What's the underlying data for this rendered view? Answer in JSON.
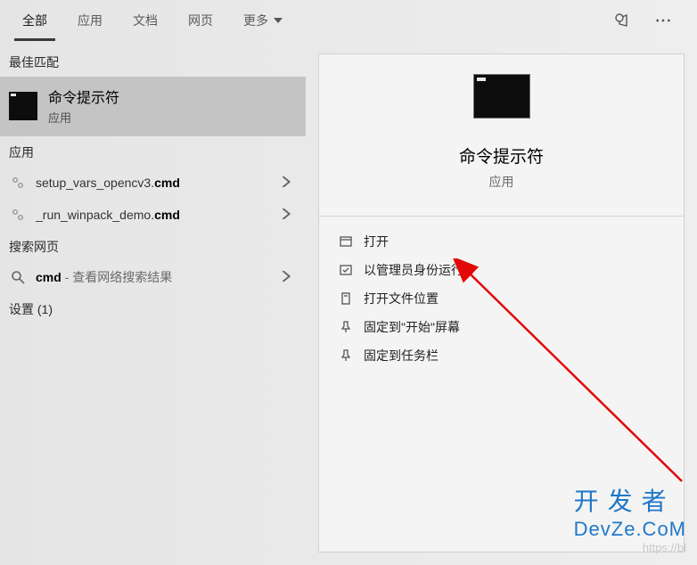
{
  "tabs": {
    "all": "全部",
    "apps": "应用",
    "docs": "文档",
    "web": "网页",
    "more": "更多"
  },
  "sections": {
    "best_match": "最佳匹配",
    "apps": "应用",
    "search_web": "搜索网页",
    "settings": "设置 (1)"
  },
  "best_match": {
    "title": "命令提示符",
    "subtitle": "应用"
  },
  "app_results": [
    {
      "prefix": "setup_vars_opencv3.",
      "bold": "cmd"
    },
    {
      "prefix": "_run_winpack_demo.",
      "bold": "cmd"
    }
  ],
  "web_result": {
    "bold": "cmd",
    "suffix": " - 查看网络搜索结果"
  },
  "preview": {
    "title": "命令提示符",
    "subtitle": "应用"
  },
  "actions": {
    "open": "打开",
    "run_admin": "以管理员身份运行",
    "open_location": "打开文件位置",
    "pin_start": "固定到\"开始\"屏幕",
    "pin_taskbar": "固定到任务栏"
  },
  "watermark": {
    "cn": "开发者",
    "en": "DevZe.CoM",
    "url": "https://bl"
  },
  "colors": {
    "accent": "#2078c8",
    "arrow": "#e30707"
  }
}
